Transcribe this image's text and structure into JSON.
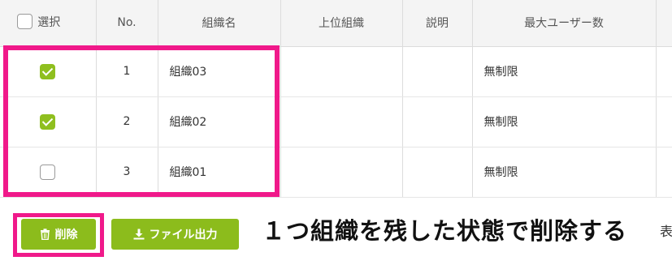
{
  "table": {
    "headers": {
      "select": "選択",
      "no": "No.",
      "org_name": "組織名",
      "parent_org": "上位組織",
      "description": "説明",
      "max_users": "最大ユーザー数"
    },
    "rows": [
      {
        "checked": true,
        "no": "1",
        "org_name": "組織03",
        "parent_org": "",
        "description": "",
        "max_users": "無制限"
      },
      {
        "checked": true,
        "no": "2",
        "org_name": "組織02",
        "parent_org": "",
        "description": "",
        "max_users": "無制限"
      },
      {
        "checked": false,
        "no": "3",
        "org_name": "組織01",
        "parent_org": "",
        "description": "",
        "max_users": "無制限"
      }
    ]
  },
  "toolbar": {
    "delete_label": "削除",
    "export_label": "ファイル出力"
  },
  "annotation": {
    "caption": "１つ組織を残した状態で削除する",
    "highlight_color": "#f0198a"
  },
  "cut_off_text": "表",
  "colors": {
    "accent": "#8cbc1c",
    "header_bg": "#f4f4f4"
  }
}
